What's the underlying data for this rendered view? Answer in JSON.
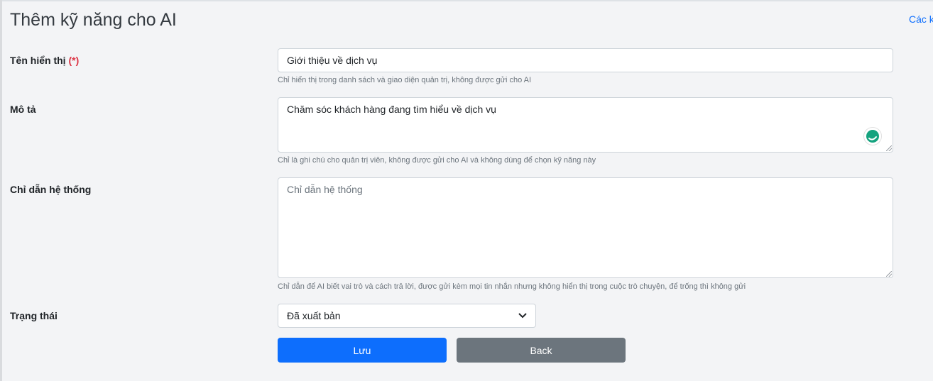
{
  "page": {
    "title": "Thêm kỹ năng cho AI",
    "top_link": "Các kỹ"
  },
  "form": {
    "display_name": {
      "label": "Tên hiển thị",
      "required_mark": "(*)",
      "value": "Giới thiệu về dịch vụ",
      "help": "Chỉ hiển thị trong danh sách và giao diện quản trị, không được gửi cho AI"
    },
    "description": {
      "label": "Mô tả",
      "value": "Chăm sóc khách hàng đang tìm hiểu về dịch vụ",
      "help": "Chỉ là ghi chú cho quản trị viên, không được gửi cho AI và không dùng để chọn kỹ năng này"
    },
    "system_instruction": {
      "label": "Chỉ dẫn hệ thống",
      "value": "",
      "placeholder": "Chỉ dẫn hệ thống",
      "help": "Chỉ dẫn để AI biết vai trò và cách trả lời, được gửi kèm mọi tin nhắn nhưng không hiển thị trong cuộc trò chuyện, để trống thì không gửi"
    },
    "status": {
      "label": "Trạng thái",
      "selected": "Đã xuất bản"
    },
    "buttons": {
      "save": "Lưu",
      "back": "Back"
    }
  },
  "colors": {
    "primary": "#0d6efd",
    "secondary": "#6c757d",
    "required": "#dc3545",
    "grammar_icon": "#15a37f"
  },
  "icons": {
    "grammar": "grammar-assistant-icon",
    "select_arrow": "chevron-down-icon"
  }
}
